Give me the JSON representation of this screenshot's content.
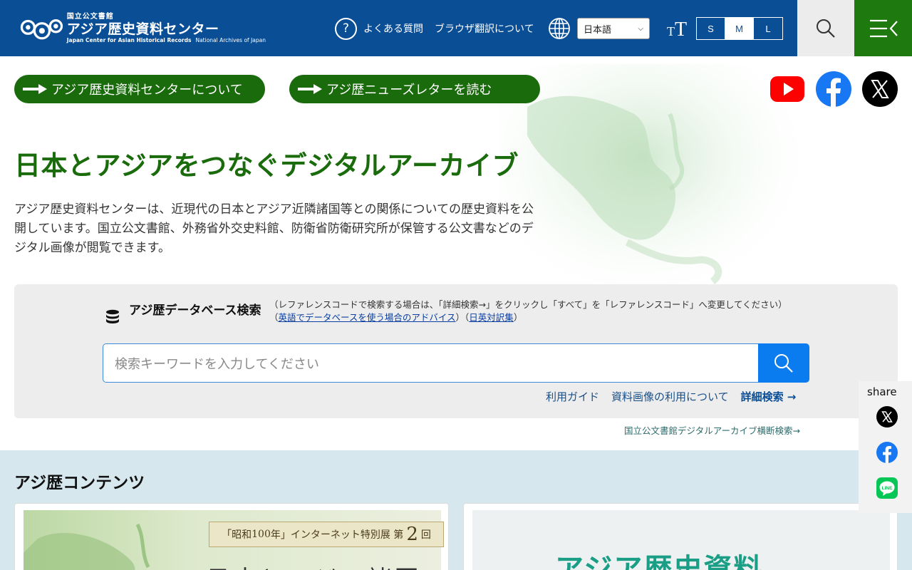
{
  "header": {
    "logo_small": "国立公文書館",
    "logo_main": "アジア歴史資料センター",
    "logo_sub_en": "Japan Center for Asian Historical Records",
    "logo_sub_org": "National Archives of Japan",
    "faq_label": "よくある質問",
    "browser_translation_label": "ブラウザ翻訳について",
    "language_selected": "日本語",
    "font_size_label_small": "T",
    "font_size_label_large": "T",
    "font_sizes": [
      "S",
      "M",
      "L"
    ],
    "font_size_active": "M",
    "accent_color": "#0a4e96",
    "menu_color": "#1e7a0e"
  },
  "top_links": [
    {
      "label": "アジア歴史資料センターについて"
    },
    {
      "label": "アジ歴ニューズレターを読む"
    }
  ],
  "social": [
    "youtube-icon",
    "facebook-icon",
    "x-icon"
  ],
  "hero": {
    "title": "日本とアジアをつなぐデジタルアーカイブ",
    "description": "アジア歴史資料センターは、近現代の日本とアジア近隣諸国等との関係についての歴史資料を公開しています。国立公文書館、外務省外交史料館、防衛省防衛研究所が保管する公文書などのデジタル画像が閲覧できます。"
  },
  "search": {
    "title": "アジ歴データベース検索",
    "note": "（レファレンスコードで検索する場合は、「詳細検索→」をクリックし「すべて」を「レファレンスコード」へ変更してください）",
    "note_link_open": "（",
    "advice_link": "英語でデータベースを使う場合のアドバイス",
    "note_link_mid": "）（",
    "glossary_link": "日英対訳集",
    "note_link_close": "）",
    "placeholder": "検索キーワードを入力してください",
    "links": {
      "guide": "利用ガイド",
      "image_use": "資料画像の利用について",
      "advanced": "詳細検索 →"
    },
    "cross_search": "国立公文書館デジタルアーカイブ横断検索→"
  },
  "share": {
    "label": "share",
    "icons": [
      "x-icon",
      "facebook-icon",
      "line-icon"
    ]
  },
  "contents": {
    "title": "アジ歴コンテンツ",
    "card1": {
      "tag_prefix": "「昭和",
      "tag_num_a": "100",
      "tag_mid": "年」インターネット特別展 第",
      "tag_num_b": "2",
      "tag_suffix": "回",
      "title": "日本とアジア諸国"
    },
    "card2": {
      "title": "アジア歴史資料"
    }
  }
}
